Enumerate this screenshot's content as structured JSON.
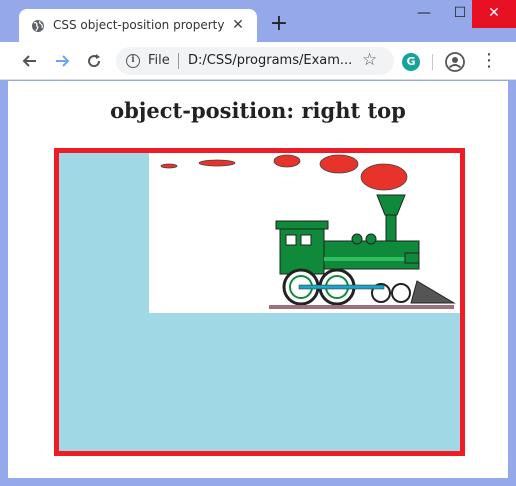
{
  "browser": {
    "tab_title": "CSS object-position property",
    "tab_close": "✕",
    "new_tab": "+",
    "window_controls": {
      "minimize": "—",
      "maximize": "☐",
      "close": "✕"
    },
    "address": {
      "scheme_label": "File",
      "url": "D:/CSS/programs/Exam..."
    },
    "extension_letter": "G"
  },
  "page": {
    "heading": "object-position: right top"
  },
  "colors": {
    "titlebar": "#95a8ea",
    "image_border": "#ee1c24",
    "image_background": "#a0d8e6",
    "train_body": "#0f8a3a",
    "smoke": "#e8332a"
  }
}
